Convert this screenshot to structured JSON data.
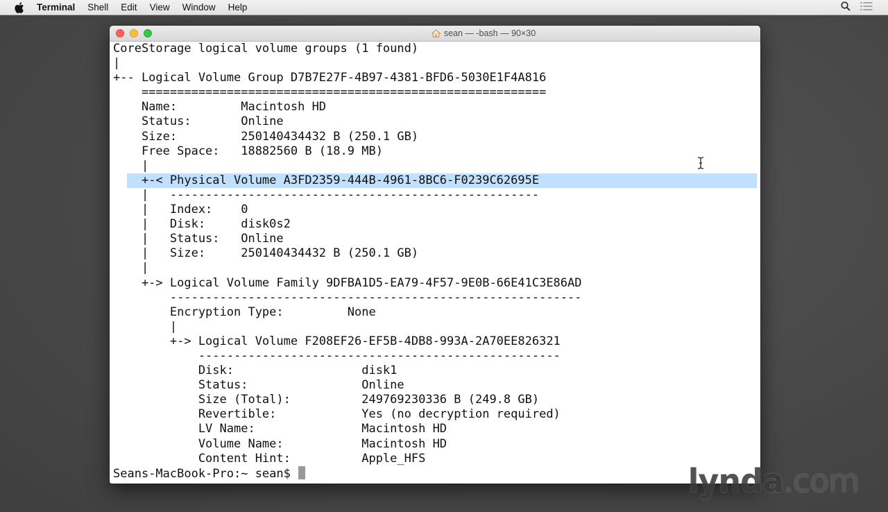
{
  "menubar": {
    "app_name": "Terminal",
    "items": [
      "Shell",
      "Edit",
      "View",
      "Window",
      "Help"
    ],
    "right_icons": [
      "spotlight-search-icon",
      "notification-center-icon"
    ]
  },
  "window": {
    "title": "sean — -bash — 90×30",
    "title_icon": "home-icon",
    "selection_color": "#c0e0fe"
  },
  "terminal": {
    "lines": [
      "CoreStorage logical volume groups (1 found)",
      "|",
      "+-- Logical Volume Group D7B7E27F-4B97-4381-BFD6-5030E1F4A816",
      "    =========================================================",
      "    Name:         Macintosh HD",
      "    Status:       Online",
      "    Size:         250140434432 B (250.1 GB)",
      "    Free Space:   18882560 B (18.9 MB)",
      "    |",
      "    +-< Physical Volume A3FD2359-444B-4961-8BC6-F0239C62695E",
      "    |   ----------------------------------------------------",
      "    |   Index:    0",
      "    |   Disk:     disk0s2",
      "    |   Status:   Online",
      "    |   Size:     250140434432 B (250.1 GB)",
      "    |",
      "    +-> Logical Volume Family 9DFBA1D5-EA79-4F57-9E0B-66E41C3E86AD",
      "        ----------------------------------------------------------",
      "        Encryption Type:         None",
      "        |",
      "        +-> Logical Volume F208EF26-EF5B-4DB8-993A-2A70EE826321",
      "            ---------------------------------------------------",
      "            Disk:                  disk1",
      "            Status:                Online",
      "            Size (Total):          249769230336 B (249.8 GB)",
      "            Revertible:            Yes (no decryption required)",
      "            LV Name:               Macintosh HD",
      "            Volume Name:           Macintosh HD",
      "            Content Hint:          Apple_HFS"
    ],
    "selected_line_index": 9,
    "prompt": "Seans-MacBook-Pro:~ sean$ "
  },
  "watermark": {
    "brand": "lynda",
    "suffix": ".com"
  }
}
